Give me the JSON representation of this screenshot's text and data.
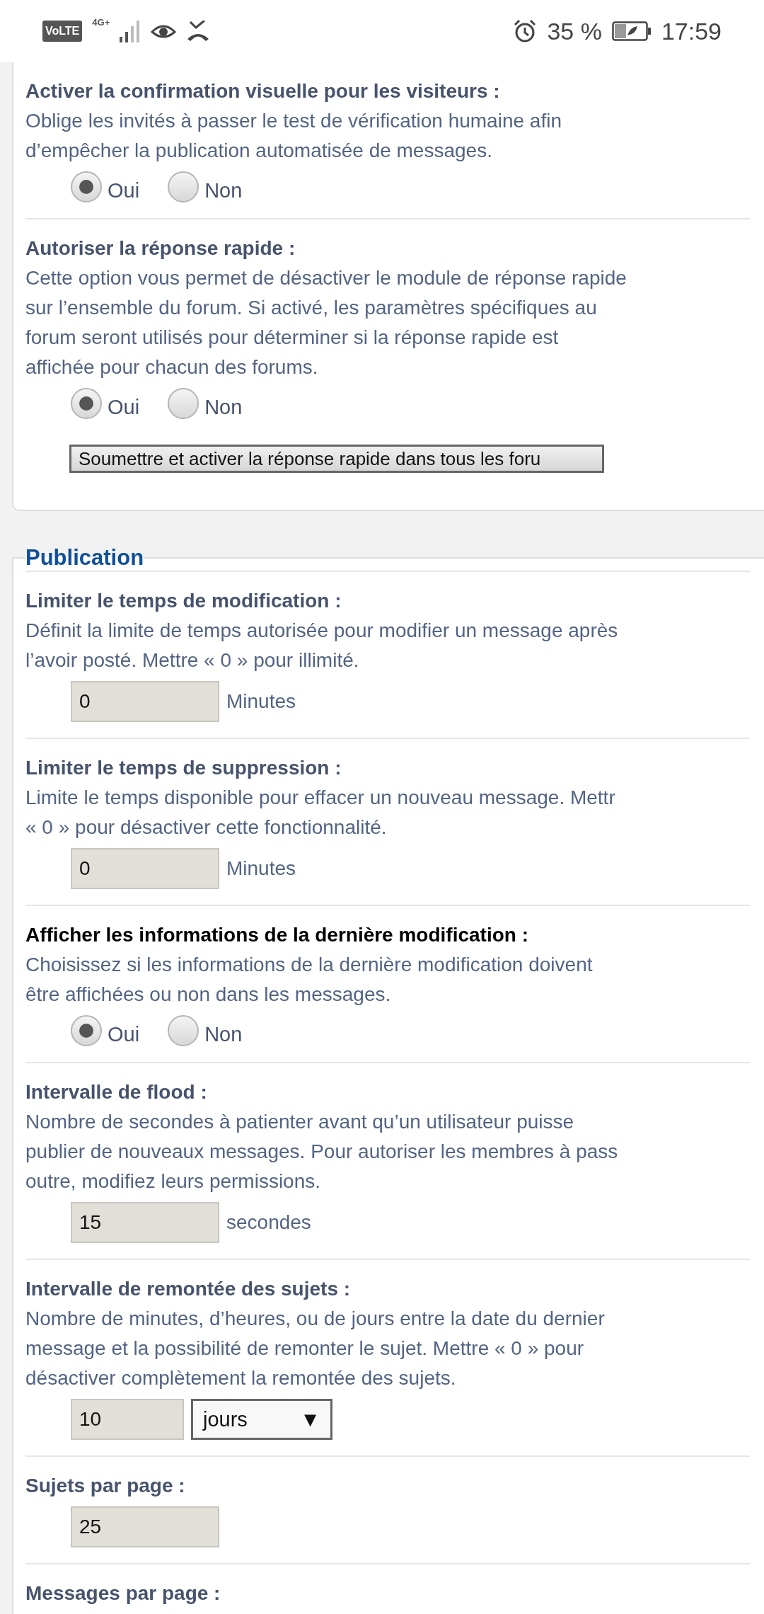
{
  "status_bar": {
    "volte": "VoLTE",
    "network": "4G+",
    "battery": "35 %",
    "time": "17:59"
  },
  "sections": [
    {
      "rows": [
        {
          "kind": "radio",
          "title": "Activer la confirmation visuelle pour les visiteurs :",
          "emphasized": false,
          "description": [
            "Oblige les invités à passer le test de vérification humaine afin",
            "d’empêcher la publication automatisée de messages."
          ],
          "options": [
            {
              "label": "Oui",
              "selected": true
            },
            {
              "label": "Non",
              "selected": false
            }
          ]
        },
        {
          "kind": "radio",
          "title": "Autoriser la réponse rapide :",
          "emphasized": false,
          "description": [
            "Cette option vous permet de désactiver le module de réponse rapide",
            "sur l’ensemble du forum. Si activé, les paramètres spécifiques au",
            "forum seront utilisés pour déterminer si la réponse rapide est",
            "affichée pour chacun des forums."
          ],
          "options": [
            {
              "label": "Oui",
              "selected": true
            },
            {
              "label": "Non",
              "selected": false
            }
          ],
          "button": "Soumettre et activer la réponse rapide dans tous les foru"
        }
      ]
    },
    {
      "legend": "Publication",
      "rows": [
        {
          "kind": "number",
          "title": "Limiter le temps de modification :",
          "emphasized": false,
          "description": [
            "Définit la limite de temps autorisée pour modifier un message après",
            "l’avoir posté. Mettre « 0 » pour illimité."
          ],
          "value": "0",
          "unit": "Minutes"
        },
        {
          "kind": "number",
          "title": "Limiter le temps de suppression :",
          "emphasized": false,
          "description": [
            "Limite le temps disponible pour effacer un nouveau message. Mettr",
            "« 0 » pour désactiver cette fonctionnalité."
          ],
          "value": "0",
          "unit": "Minutes"
        },
        {
          "kind": "radio",
          "title": "Afficher les informations de la dernière modification :",
          "emphasized": true,
          "description": [
            "Choisissez si les informations de la dernière modification doivent",
            "être affichées ou non dans les messages."
          ],
          "options": [
            {
              "label": "Oui",
              "selected": true
            },
            {
              "label": "Non",
              "selected": false
            }
          ]
        },
        {
          "kind": "number",
          "title": "Intervalle de flood :",
          "emphasized": false,
          "description": [
            "Nombre de secondes à patienter avant qu’un utilisateur puisse",
            "publier de nouveaux messages. Pour autoriser les membres à pass",
            "outre, modifiez leurs permissions."
          ],
          "value": "15",
          "unit": "secondes"
        },
        {
          "kind": "select",
          "title": "Intervalle de remontée des sujets :",
          "emphasized": false,
          "description": [
            "Nombre de minutes, d’heures, ou de jours entre la date du dernier",
            "message et la possibilité de remonter le sujet. Mettre « 0 » pour",
            "désactiver complètement la remontée des sujets."
          ],
          "value": "10",
          "select": "jours",
          "arrow": "▼"
        },
        {
          "kind": "number",
          "title": "Sujets par page :",
          "emphasized": false,
          "value": "25"
        },
        {
          "kind": "title",
          "title": "Messages par page :",
          "emphasized": false
        }
      ]
    }
  ]
}
